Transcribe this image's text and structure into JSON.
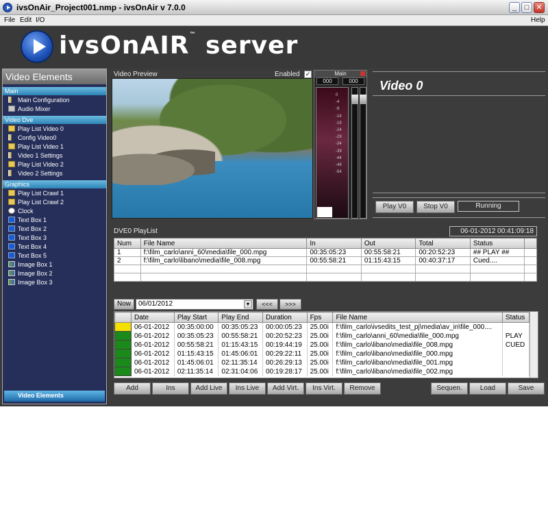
{
  "window": {
    "title": "ivsOnAir_Project001.nmp - ivsOnAir v 7.0.0",
    "min": "_",
    "max": "□",
    "close": "✕"
  },
  "menu": {
    "file": "File",
    "edit": "Edit",
    "io": "I/O",
    "help": "Help"
  },
  "logo": {
    "brand": "ivsOnAIR",
    "tm": "™",
    "server": " server"
  },
  "sidebar": {
    "title": "Video Elements",
    "sections": [
      {
        "label": "Main",
        "items": [
          {
            "label": "Main Configuration",
            "icon": "tree-icon"
          },
          {
            "label": "Audio Mixer",
            "icon": "mixer-icon"
          }
        ]
      },
      {
        "label": "Video Dve",
        "items": [
          {
            "label": "Play List Video 0",
            "icon": "folder-icon"
          },
          {
            "label": "Config Video0",
            "icon": "tree-icon"
          },
          {
            "label": "Play List Video 1",
            "icon": "folder-icon"
          },
          {
            "label": "Video 1 Settings",
            "icon": "tree-icon"
          },
          {
            "label": "Play List Video 2",
            "icon": "folder-icon"
          },
          {
            "label": "Video 2 Settings",
            "icon": "tree-icon"
          }
        ]
      },
      {
        "label": "Graphics",
        "items": [
          {
            "label": "Play List Crawl 1",
            "icon": "folder-icon"
          },
          {
            "label": "Play List Crawl 2",
            "icon": "folder-icon"
          },
          {
            "label": "Clock",
            "icon": "clock-icon"
          },
          {
            "label": "Text Box 1",
            "icon": "text-icon"
          },
          {
            "label": "Text Box 2",
            "icon": "text-icon"
          },
          {
            "label": "Text Box 3",
            "icon": "text-icon"
          },
          {
            "label": "Text Box 4",
            "icon": "text-icon"
          },
          {
            "label": "Text Box 5",
            "icon": "text-icon"
          },
          {
            "label": "Image Box 1",
            "icon": "image-icon"
          },
          {
            "label": "Image Box 2",
            "icon": "image-icon"
          },
          {
            "label": "Image Box 3",
            "icon": "image-icon"
          }
        ]
      }
    ],
    "footer": "Video Elements"
  },
  "preview": {
    "label": "Video Preview",
    "enabled_label": "Enabled",
    "enabled": true
  },
  "vu": {
    "channel": "Main",
    "left": "000",
    "right": "000",
    "scale": [
      "0",
      "-4",
      "-9",
      "-14",
      "-19",
      "-24",
      "-29",
      "-34",
      "-39",
      "-44",
      "-49",
      "-54"
    ],
    "level": 0.08
  },
  "video0": {
    "title": "Video 0",
    "play": "Play V0",
    "stop": "Stop V0",
    "status": "Running"
  },
  "playlist": {
    "title": "DVE0 PlayList",
    "datetime": "06-01-2012    00:41:09:18",
    "columns": [
      "Num",
      "File Name",
      "In",
      "Out",
      "Total",
      "Status"
    ],
    "rows": [
      [
        "1",
        "f:\\film_carlo\\anni_60\\media\\file_000.mpg",
        "00:35:05:23",
        "00:55:58:21",
        "00:20:52:23",
        "## PLAY ##"
      ],
      [
        "2",
        "f:\\film_carlo\\libano\\media\\file_008.mpg",
        "00:55:58:21",
        "01:15:43:15",
        "00:40:37:17",
        "Cued...."
      ]
    ]
  },
  "schedule": {
    "now": "Now",
    "date": "06/01/2012",
    "prev": "<<<",
    "next": ">>>",
    "columns": [
      "",
      "Date",
      "Play Start",
      "Play End",
      "Duration",
      "Fps",
      "File Name",
      "Status"
    ],
    "rows": [
      {
        "swatch": "#f4e000",
        "date": "06-01-2012",
        "start": "00:35:00:00",
        "end": "00:35:05:23",
        "dur": "00:00:05:23",
        "fps": "25.00i",
        "file": "f:\\film_carlo\\ivsedits_test_pj\\media\\av_in\\file_000....",
        "status": ""
      },
      {
        "swatch": "#1a8a1a",
        "date": "06-01-2012",
        "start": "00:35:05:23",
        "end": "00:55:58:21",
        "dur": "00:20:52:23",
        "fps": "25.00i",
        "file": "f:\\film_carlo\\anni_60\\media\\file_000.mpg",
        "status": "PLAY"
      },
      {
        "swatch": "#1a8a1a",
        "date": "06-01-2012",
        "start": "00:55:58:21",
        "end": "01:15:43:15",
        "dur": "00:19:44:19",
        "fps": "25.00i",
        "file": "f:\\film_carlo\\libano\\media\\file_008.mpg",
        "status": "CUED"
      },
      {
        "swatch": "#1a8a1a",
        "date": "06-01-2012",
        "start": "01:15:43:15",
        "end": "01:45:06:01",
        "dur": "00:29:22:11",
        "fps": "25.00i",
        "file": "f:\\film_carlo\\libano\\media\\file_000.mpg",
        "status": ""
      },
      {
        "swatch": "#1a8a1a",
        "date": "06-01-2012",
        "start": "01:45:06:01",
        "end": "02:11:35:14",
        "dur": "00:26:29:13",
        "fps": "25.00i",
        "file": "f:\\film_carlo\\libano\\media\\file_001.mpg",
        "status": ""
      },
      {
        "swatch": "#1a8a1a",
        "date": "06-01-2012",
        "start": "02:11:35:14",
        "end": "02:31:04:06",
        "dur": "00:19:28:17",
        "fps": "25.00i",
        "file": "f:\\film_carlo\\libano\\media\\file_002.mpg",
        "status": ""
      }
    ]
  },
  "toolbar": {
    "add": "Add",
    "ins": "Ins",
    "add_live": "Add Live",
    "ins_live": "Ins Live",
    "add_virt": "Add Virt.",
    "ins_virt": "Ins Virt.",
    "remove": "Remove",
    "sequen": "Sequen.",
    "load": "Load",
    "save": "Save"
  }
}
